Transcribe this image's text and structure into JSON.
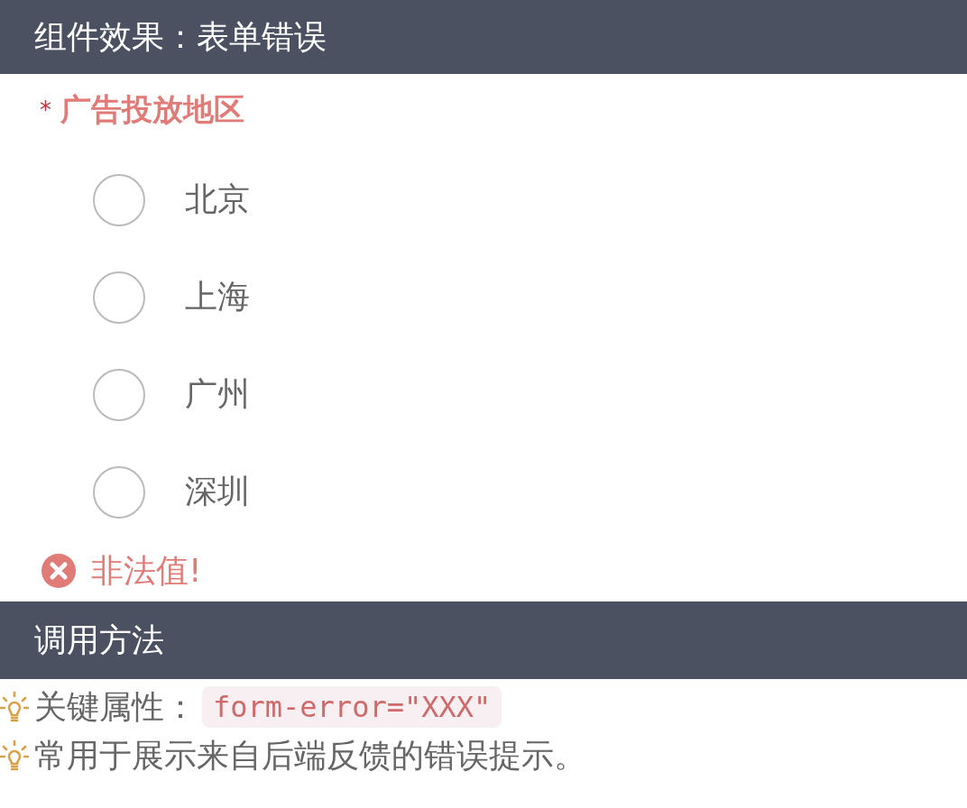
{
  "demo_section": {
    "title": "组件效果：表单错误"
  },
  "field": {
    "required_mark": "*",
    "label": "广告投放地区",
    "error_state": true,
    "options": [
      {
        "label": "北京",
        "selected": false
      },
      {
        "label": "上海",
        "selected": false
      },
      {
        "label": "广州",
        "selected": false
      },
      {
        "label": "深圳",
        "selected": false
      }
    ],
    "error_message": "非法值!"
  },
  "usage_section": {
    "title": "调用方法",
    "tips": [
      {
        "text": "关键属性：",
        "code": "form-error=\"XXX\""
      },
      {
        "text": "常用于展示来自后端反馈的错误提示。"
      }
    ]
  }
}
